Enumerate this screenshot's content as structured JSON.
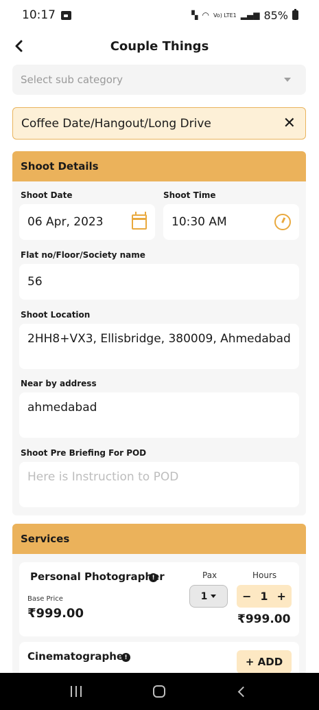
{
  "status_bar": {
    "time": "10:17",
    "network_label": "Vo) LTE1",
    "battery": "85%"
  },
  "header": {
    "title": "Couple Things"
  },
  "sub_category": {
    "placeholder": "Select sub category"
  },
  "selected_chip": {
    "label": "Coffee Date/Hangout/Long Drive",
    "close": "✕"
  },
  "shoot_details": {
    "heading": "Shoot Details",
    "date_label": "Shoot Date",
    "date_value": "06 Apr, 2023",
    "time_label": "Shoot Time",
    "time_value": "10:30 AM",
    "flat_label": "Flat no/Floor/Society name",
    "flat_value": "56",
    "location_label": "Shoot Location",
    "location_value": "2HH8+VX3, Ellisbridge, 380009, Ahmedabad",
    "near_label": "Near by address",
    "near_value": "ahmedabad",
    "briefing_label": "Shoot Pre Briefing For POD",
    "briefing_placeholder": "Here is Instruction to POD"
  },
  "services": {
    "heading": "Services",
    "items": [
      {
        "name": "Personal Photographer",
        "pax_label": "Pax",
        "hours_label": "Hours",
        "base_price_label": "Base Price",
        "base_price": "₹999.00",
        "pax_value": "1",
        "hours_value": "1",
        "minus": "−",
        "plus": "+",
        "total": "₹999.00"
      },
      {
        "name": "Cinematographer",
        "add_label": "+ ADD"
      }
    ],
    "info_glyph": "!"
  },
  "colors": {
    "accent": "#ebb25b",
    "chip_bg": "#fdf0d7",
    "stepper_bg": "#fde8c3"
  },
  "icons": {
    "back": "chevron-left-icon",
    "calendar": "calendar-icon",
    "clock": "clock-icon",
    "close": "close-icon",
    "info": "info-icon"
  }
}
